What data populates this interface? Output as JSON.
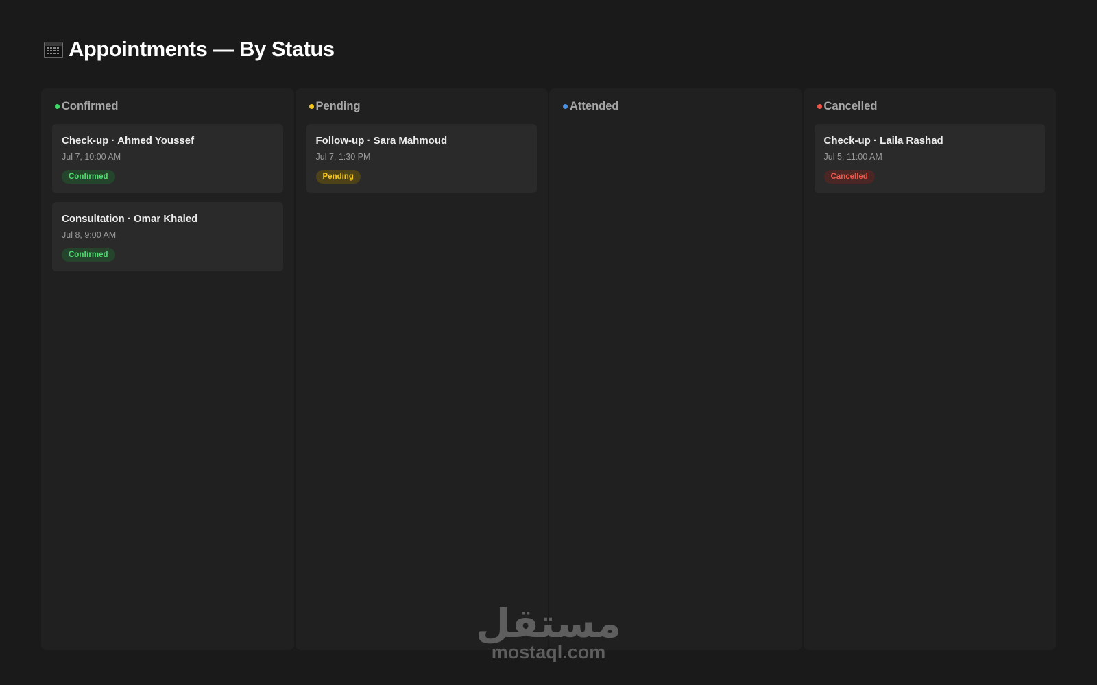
{
  "header": {
    "title": "Appointments — By Status",
    "icon": "calendar-icon"
  },
  "columns": [
    {
      "key": "confirmed",
      "label": "Confirmed",
      "color": "#3ddc6a",
      "cards": [
        {
          "title": "Check-up · Ahmed Youssef",
          "time": "Jul 7, 10:00 AM",
          "badge": "Confirmed"
        },
        {
          "title": "Consultation · Omar Khaled",
          "time": "Jul 8, 9:00 AM",
          "badge": "Confirmed"
        }
      ]
    },
    {
      "key": "pending",
      "label": "Pending",
      "color": "#f5c518",
      "cards": [
        {
          "title": "Follow-up · Sara Mahmoud",
          "time": "Jul 7, 1:30 PM",
          "badge": "Pending"
        }
      ]
    },
    {
      "key": "attended",
      "label": "Attended",
      "color": "#4a90e2",
      "cards": []
    },
    {
      "key": "cancelled",
      "label": "Cancelled",
      "color": "#f0564a",
      "cards": [
        {
          "title": "Check-up · Laila Rashad",
          "time": "Jul 5, 11:00 AM",
          "badge": "Cancelled"
        }
      ]
    }
  ],
  "badge_styles": {
    "Confirmed": {
      "bg": "#24452c",
      "fg": "#4ade6c"
    },
    "Pending": {
      "bg": "#4d4218",
      "fg": "#f5c518"
    },
    "Cancelled": {
      "bg": "#4a2624",
      "fg": "#f0564a"
    }
  },
  "watermark": {
    "logo_text": "مستقل",
    "url": "mostaql.com"
  }
}
